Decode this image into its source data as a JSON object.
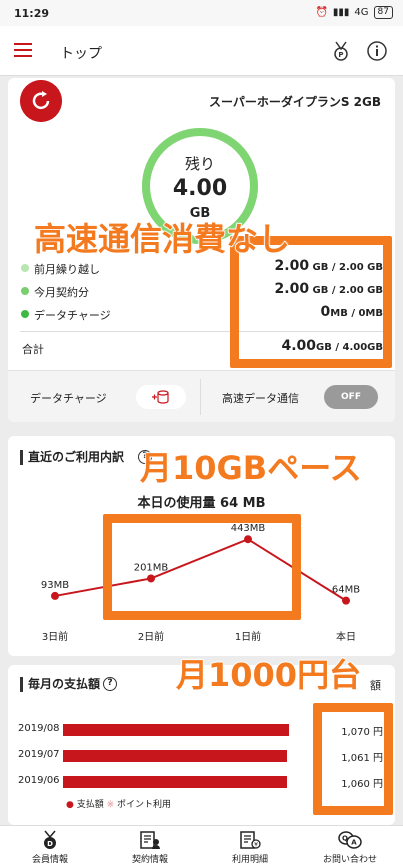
{
  "status": {
    "time": "11:29",
    "network": "4G",
    "battery": "87"
  },
  "appbar": {
    "title": "トップ"
  },
  "plan": {
    "name": "スーパーホーダイプランS 2GB",
    "remaining_label": "残り",
    "remaining_value": "4.00",
    "remaining_unit": "GB",
    "remaining_fraction": 1.0,
    "rows": [
      {
        "label": "前月繰り越し",
        "value": "2.00",
        "unit": "GB",
        "total": "/ 2.00 GB",
        "color": "#b8e6b1"
      },
      {
        "label": "今月契約分",
        "value": "2.00",
        "unit": "GB",
        "total": "/ 2.00 GB",
        "color": "#79cf6d"
      },
      {
        "label": "データチャージ",
        "value": "0",
        "unit": "MB",
        "total": "/ 0MB",
        "color": "#3fb944"
      }
    ],
    "total": {
      "label": "合計",
      "value": "4.00",
      "unit": "GB",
      "total": "/ 4.00GB"
    },
    "charge_label": "データチャージ",
    "highspeed_label": "高速データ通信",
    "toggle_label": "OFF"
  },
  "usage": {
    "title": "直近のご利用内訳",
    "today_label": "本日の使用量",
    "today_value": "64 MB"
  },
  "chart_data": {
    "type": "line",
    "categories": [
      "3日前",
      "2日前",
      "1日前",
      "本日"
    ],
    "values": [
      93,
      201,
      443,
      64
    ],
    "data_labels": [
      "93MB",
      "201MB",
      "443MB",
      "64MB"
    ],
    "ylim": [
      0,
      500
    ],
    "color": "#c8161d",
    "grid": false
  },
  "payments": {
    "title": "毎月の支払額",
    "header_suffix": "額",
    "rows": [
      {
        "month": "2019/08",
        "amount": "1,070 円",
        "value": 1070
      },
      {
        "month": "2019/07",
        "amount": "1,061 円",
        "value": 1061
      },
      {
        "month": "2019/06",
        "amount": "1,060 円",
        "value": 1060
      }
    ],
    "legend_paid": "支払額",
    "legend_points": "ポイント利用"
  },
  "nav": [
    {
      "label": "会員情報",
      "icon": "member-icon"
    },
    {
      "label": "契約情報",
      "icon": "contract-icon"
    },
    {
      "label": "利用明細",
      "icon": "statement-icon"
    },
    {
      "label": "お問い合わせ",
      "icon": "qa-icon"
    }
  ],
  "annotations": {
    "a1": "高速通信消費なし",
    "a2": "月10GBペース",
    "a3": "月1000円台"
  },
  "colors": {
    "brand": "#c8161d",
    "annotation": "#f47a20"
  }
}
